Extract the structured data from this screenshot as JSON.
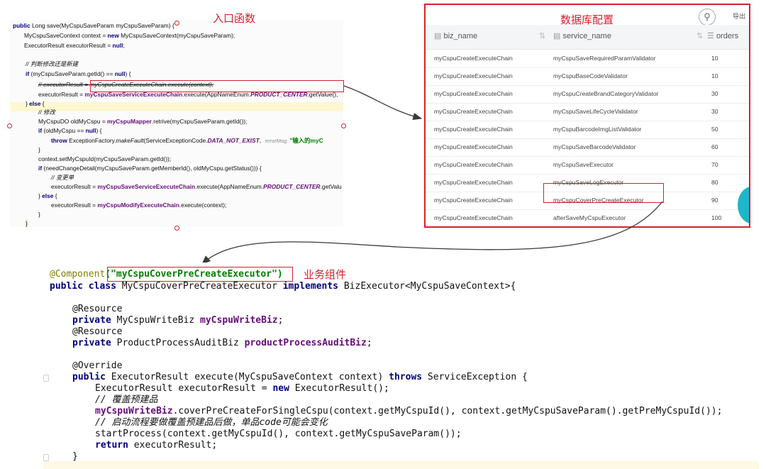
{
  "labels": {
    "entry": "入口函数",
    "db_config": "数据库配置",
    "biz_component": "业务组件"
  },
  "code_top": {
    "line1_kw": "public",
    "line1_rest": " Long save(MyCspuSaveParam myCspuSaveParam) {",
    "line2": "MyCspuSaveContext context = ",
    "line2_kw": "new",
    "line2_rest": " MyCspuSaveContext(myCspuSaveParam);",
    "line3": "ExecutorResult executorResult = ",
    "line3_kw": "null",
    "line3_rest": ";",
    "line4": "// 判断修改还是新建",
    "line5_kw": "if",
    "line5_rest": " (myCspuSaveParam.getId() == ",
    "line5_kw2": "null",
    "line5_end": ") {",
    "line6": "// executorResult = myCspuCreateExecuteChain.execute(context);",
    "line7_a": "executorResult = ",
    "line7_b": "myCspuSaveServiceExecuteChain",
    "line7_c": ".execute(AppNameEnum.",
    "line7_d": "PRODUCT_CENTER",
    "line7_e": ".getValue(),",
    "line8_a": "} ",
    "line8_kw": "else",
    "line8_b": " {",
    "line9": "// 修改",
    "line10_a": "MyCspuDO oldMyCspu = ",
    "line10_b": "myCspuMapper",
    "line10_c": ".retrive(myCspuSaveParam.getId());",
    "line11_kw": "if",
    "line11_rest": " (oldMyCspu == ",
    "line11_kw2": "null",
    "line11_end": ") {",
    "line12_kw": "throw",
    "line12_a": " ExceptionFactory.",
    "line12_b": "makeFault",
    "line12_c": "(ServiceExceptionCode.",
    "line12_d": "DATA_NOT_EXIST",
    "line12_e": ",",
    "line12_hint": "errorMsg:",
    "line12_str": "\"输入的myC",
    "line13": "}",
    "line14": "context.setMyCspuId(myCspuSaveParam.getId());",
    "line15_kw": "if",
    "line15_rest": " (needChangeDetail(myCspuSaveParam.getMemberId(), oldMyCspu.getStatus())) {",
    "line16": "// 变更单",
    "line17_a": "executorResult = ",
    "line17_b": "myCspuSaveServiceExecuteChain",
    "line17_c": ".execute(AppNameEnum.",
    "line17_d": "PRODUCT_CENTER",
    "line17_e": ".getValu",
    "line18_a": "} ",
    "line18_kw": "else",
    "line18_b": " {",
    "line19_a": "executorResult = ",
    "line19_b": "myCspuModifyExecuteChain",
    "line19_c": ".execute(context);",
    "line20": "}",
    "line21": "}"
  },
  "db_table": {
    "export_label": "导出",
    "columns": [
      "biz_name",
      "service_name",
      "orders"
    ],
    "rows": [
      [
        "myCspuCreateExecuteChain",
        "myCspuSaveRequiredParamValidator",
        "10"
      ],
      [
        "myCspuCreateExecuteChain",
        "myCspuBaseCodeValidator",
        "10"
      ],
      [
        "myCspuCreateExecuteChain",
        "myCspuCreateBrandCategoryValidator",
        "30"
      ],
      [
        "myCspuCreateExecuteChain",
        "myCspuSaveLifeCycleValidator",
        "30"
      ],
      [
        "myCspuCreateExecuteChain",
        "myCspuBarcodeImgListValidator",
        "50"
      ],
      [
        "myCspuCreateExecuteChain",
        "myCspuSaveBarcodeValidator",
        "60"
      ],
      [
        "myCspuCreateExecuteChain",
        "myCspuSaveExecutor",
        "70"
      ],
      [
        "myCspuCreateExecuteChain",
        "myCspuSaveLogExecutor",
        "80"
      ],
      [
        "myCspuCreateExecuteChain",
        "myCspuCoverPreCreateExecutor",
        "90"
      ],
      [
        "myCspuCreateExecuteChain",
        "afterSaveMyCspuExecutor",
        "100"
      ]
    ]
  },
  "code_bottom": {
    "l1_ann": "@Component",
    "l1_str": "(\"myCspuCoverPreCreateExecutor\")",
    "l2_kw": "public class",
    "l2_a": " MyCspuCoverPreCreateExecutor ",
    "l2_kw2": "implements",
    "l2_b": " BizExecutor<MyCspuSaveContext>{",
    "l3": "@Resource",
    "l4_kw": "private",
    "l4_a": " MyCspuWriteBiz ",
    "l4_b": "myCspuWriteBiz",
    "l4_c": ";",
    "l5": "@Resource",
    "l6_kw": "private",
    "l6_a": " ProductProcessAuditBiz ",
    "l6_b": "productProcessAuditBiz",
    "l6_c": ";",
    "l7": "@Override",
    "l8_kw": "public",
    "l8_a": " ExecutorResult execute(MyCspuSaveContext context) ",
    "l8_kw2": "throws",
    "l8_b": " ServiceException {",
    "l9_a": "ExecutorResult executorResult = ",
    "l9_kw": "new",
    "l9_b": " ExecutorResult();",
    "l10": "// 覆盖预建品",
    "l11_a": "myCspuWriteBiz",
    "l11_b": ".coverPreCreateForSingleCspu(context.getMyCspuId(), context.getMyCspuSaveParam().getPreMyCspuId());",
    "l12": "// 启动流程要做覆盖预建品后做，单品code可能会变化",
    "l13": "startProcess(context.getMyCspuId(), context.getMyCspuSaveParam());",
    "l14_kw": "return",
    "l14_a": " executorResult;",
    "l15": "}"
  }
}
